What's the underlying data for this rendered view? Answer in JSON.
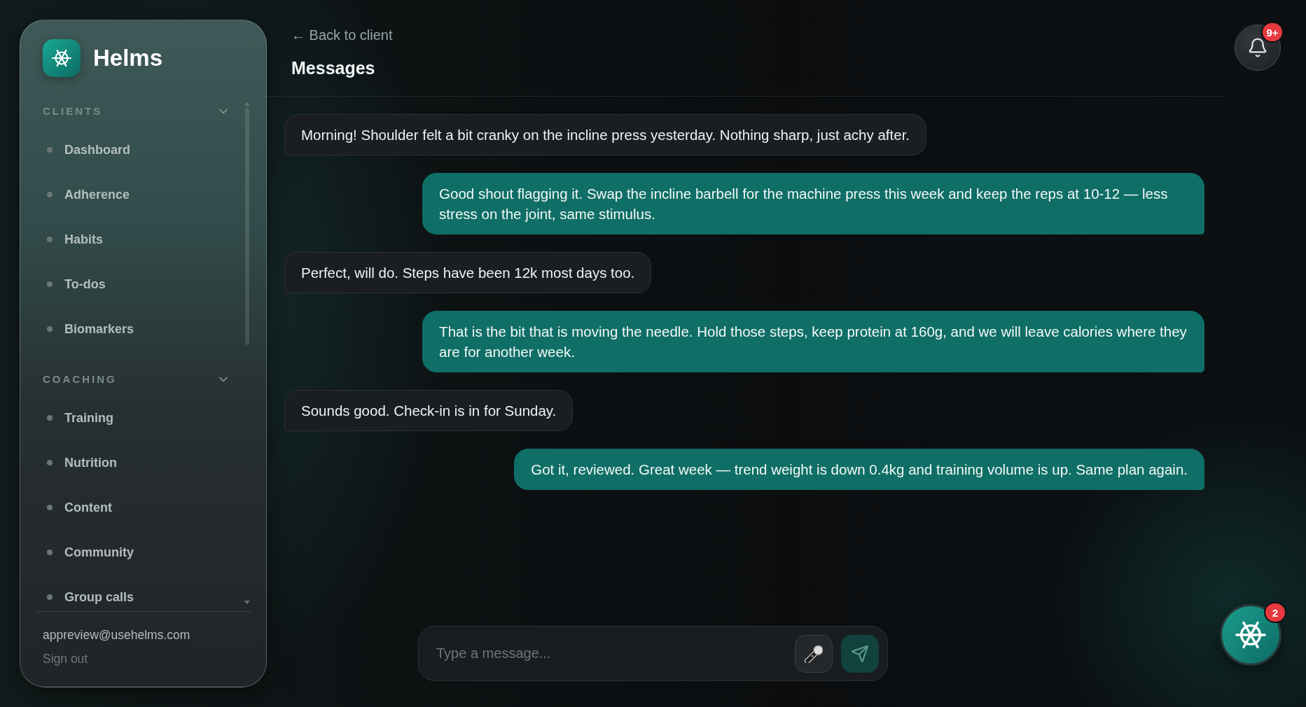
{
  "sidebar": {
    "brand": "Helms",
    "sections": [
      {
        "label": "CLIENTS",
        "expanded": true,
        "items": [
          {
            "label": "Dashboard",
            "selected": false
          },
          {
            "label": "Adherence",
            "selected": false
          },
          {
            "label": "Habits",
            "selected": false
          },
          {
            "label": "To-dos",
            "selected": false
          },
          {
            "label": "Biomarkers",
            "selected": false
          }
        ]
      },
      {
        "label": "COACHING",
        "expanded": true,
        "items": [
          {
            "label": "Training",
            "selected": false
          },
          {
            "label": "Nutrition",
            "selected": false
          },
          {
            "label": "Content",
            "selected": false
          },
          {
            "label": "Community",
            "selected": false
          },
          {
            "label": "Group calls",
            "selected": false
          }
        ]
      }
    ],
    "account": {
      "email": "appreview@usehelms.com",
      "sign_out": "Sign out"
    }
  },
  "header": {
    "back_link": "← Back to client",
    "title": "Messages"
  },
  "notifications": {
    "badge": "9+"
  },
  "messages": [
    {
      "kind": "incoming",
      "text": "Morning! Shoulder felt a bit cranky on the incline press yesterday. Nothing sharp, just achy after."
    },
    {
      "kind": "outgoing",
      "text": "Good shout flagging it. Swap the incline barbell for the machine press this week and keep the reps at 10-12 — less stress on the joint, same stimulus."
    },
    {
      "kind": "incoming",
      "text": "Perfect, will do. Steps have been 12k most days too."
    },
    {
      "kind": "outgoing",
      "text": "That is the bit that is moving the needle. Hold those steps, keep protein at 160g, and we will leave calories where they are for another week."
    },
    {
      "kind": "incoming",
      "text": "Sounds good. Check-in is in for Sunday."
    },
    {
      "kind": "outgoing",
      "text": "Got it, reviewed. Great week — trend weight is down 0.4kg and training volume is up. Same plan again."
    }
  ],
  "composer": {
    "placeholder": "Type a message..."
  },
  "assistant": {
    "badge": "2"
  }
}
